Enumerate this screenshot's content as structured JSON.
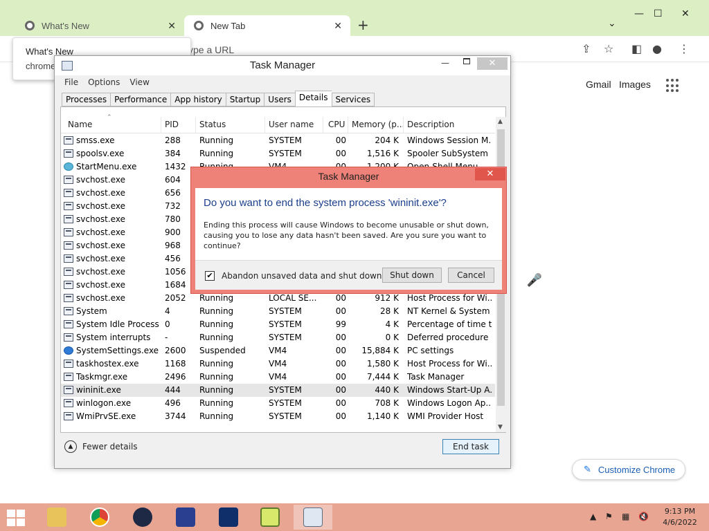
{
  "browser": {
    "tabs": [
      {
        "label": "What's New"
      },
      {
        "label": "New Tab"
      }
    ],
    "omnibox_placeholder": "ype a URL",
    "whats_new_popup": {
      "title": "What's New",
      "subtitle": "chrome"
    },
    "ntp_links": {
      "gmail": "Gmail",
      "images": "Images"
    },
    "customize_label": "Customize Chrome"
  },
  "task_manager": {
    "title": "Task Manager",
    "menu": [
      "File",
      "Options",
      "View"
    ],
    "tabs": [
      "Processes",
      "Performance",
      "App history",
      "Startup",
      "Users",
      "Details",
      "Services"
    ],
    "active_tab": "Details",
    "columns": [
      "Name",
      "PID",
      "Status",
      "User name",
      "CPU",
      "Memory (p...",
      "Description"
    ],
    "rows": [
      {
        "name": "smss.exe",
        "pid": "288",
        "status": "Running",
        "user": "SYSTEM",
        "cpu": "00",
        "mem": "204 K",
        "desc": "Windows Session M...",
        "icon": "window-icon"
      },
      {
        "name": "spoolsv.exe",
        "pid": "384",
        "status": "Running",
        "user": "SYSTEM",
        "cpu": "00",
        "mem": "1,516 K",
        "desc": "Spooler SubSystem ...",
        "icon": "printer-icon"
      },
      {
        "name": "StartMenu.exe",
        "pid": "1432",
        "status": "Running",
        "user": "VM4",
        "cpu": "00",
        "mem": "1,200 K",
        "desc": "Open-Shell Menu",
        "icon": "shell-icon"
      },
      {
        "name": "svchost.exe",
        "pid": "604",
        "status": "",
        "user": "",
        "cpu": "",
        "mem": "",
        "desc": "",
        "icon": "window-icon"
      },
      {
        "name": "svchost.exe",
        "pid": "656",
        "status": "",
        "user": "",
        "cpu": "",
        "mem": "",
        "desc": "",
        "icon": "window-icon"
      },
      {
        "name": "svchost.exe",
        "pid": "732",
        "status": "",
        "user": "",
        "cpu": "",
        "mem": "",
        "desc": "",
        "icon": "window-icon"
      },
      {
        "name": "svchost.exe",
        "pid": "780",
        "status": "",
        "user": "",
        "cpu": "",
        "mem": "",
        "desc": "",
        "icon": "window-icon"
      },
      {
        "name": "svchost.exe",
        "pid": "900",
        "status": "",
        "user": "",
        "cpu": "",
        "mem": "",
        "desc": "",
        "icon": "window-icon"
      },
      {
        "name": "svchost.exe",
        "pid": "968",
        "status": "",
        "user": "",
        "cpu": "",
        "mem": "",
        "desc": "",
        "icon": "window-icon"
      },
      {
        "name": "svchost.exe",
        "pid": "456",
        "status": "",
        "user": "",
        "cpu": "",
        "mem": "",
        "desc": "",
        "icon": "window-icon"
      },
      {
        "name": "svchost.exe",
        "pid": "1056",
        "status": "",
        "user": "",
        "cpu": "",
        "mem": "",
        "desc": "",
        "icon": "window-icon"
      },
      {
        "name": "svchost.exe",
        "pid": "1684",
        "status": "",
        "user": "",
        "cpu": "",
        "mem": "",
        "desc": "",
        "icon": "window-icon"
      },
      {
        "name": "svchost.exe",
        "pid": "2052",
        "status": "Running",
        "user": "LOCAL SE...",
        "cpu": "00",
        "mem": "912 K",
        "desc": "Host Process for Wi...",
        "icon": "window-icon"
      },
      {
        "name": "System",
        "pid": "4",
        "status": "Running",
        "user": "SYSTEM",
        "cpu": "00",
        "mem": "28 K",
        "desc": "NT Kernel & System",
        "icon": "window-icon"
      },
      {
        "name": "System Idle Process",
        "pid": "0",
        "status": "Running",
        "user": "SYSTEM",
        "cpu": "99",
        "mem": "4 K",
        "desc": "Percentage of time t...",
        "icon": "window-icon"
      },
      {
        "name": "System interrupts",
        "pid": "-",
        "status": "Running",
        "user": "SYSTEM",
        "cpu": "00",
        "mem": "0 K",
        "desc": "Deferred procedure ...",
        "icon": "window-icon"
      },
      {
        "name": "SystemSettings.exe",
        "pid": "2600",
        "status": "Suspended",
        "user": "VM4",
        "cpu": "00",
        "mem": "15,884 K",
        "desc": "PC settings",
        "icon": "gear-icon"
      },
      {
        "name": "taskhostex.exe",
        "pid": "1168",
        "status": "Running",
        "user": "VM4",
        "cpu": "00",
        "mem": "1,580 K",
        "desc": "Host Process for Wi...",
        "icon": "window-icon"
      },
      {
        "name": "Taskmgr.exe",
        "pid": "2496",
        "status": "Running",
        "user": "VM4",
        "cpu": "00",
        "mem": "7,444 K",
        "desc": "Task Manager",
        "icon": "taskmgr-icon"
      },
      {
        "name": "wininit.exe",
        "pid": "444",
        "status": "Running",
        "user": "SYSTEM",
        "cpu": "00",
        "mem": "440 K",
        "desc": "Windows Start-Up A...",
        "icon": "window-icon",
        "selected": true
      },
      {
        "name": "winlogon.exe",
        "pid": "496",
        "status": "Running",
        "user": "SYSTEM",
        "cpu": "00",
        "mem": "708 K",
        "desc": "Windows Logon Ap...",
        "icon": "window-icon"
      },
      {
        "name": "WmiPrvSE.exe",
        "pid": "3744",
        "status": "Running",
        "user": "SYSTEM",
        "cpu": "00",
        "mem": "1,140 K",
        "desc": "WMI Provider Host",
        "icon": "wmi-icon"
      }
    ],
    "fewer_details": "Fewer details",
    "end_task": "End task"
  },
  "dialog": {
    "title": "Task Manager",
    "heading": "Do you want to end the system process 'wininit.exe'?",
    "message": "Ending this process will cause Windows to become unusable or shut down, causing you to lose any data hasn't been saved. Are you sure you want to continue?",
    "checkbox_label": "Abandon unsaved data and shut down.",
    "checkbox_checked": true,
    "shutdown_label": "Shut down",
    "cancel_label": "Cancel"
  },
  "taskbar": {
    "apps": [
      "file-explorer-icon",
      "chrome-icon",
      "ccleaner-icon",
      "network-tool-icon",
      "shield-app-icon",
      "notepad-app-icon",
      "task-manager-icon"
    ],
    "time": "9:13 PM",
    "date": "4/6/2022"
  },
  "colors": {
    "desktop": "#c9e3a8",
    "dialog_frame": "#ee8178",
    "taskbar": "#e8a592",
    "heading_blue": "#1a3e8c"
  }
}
